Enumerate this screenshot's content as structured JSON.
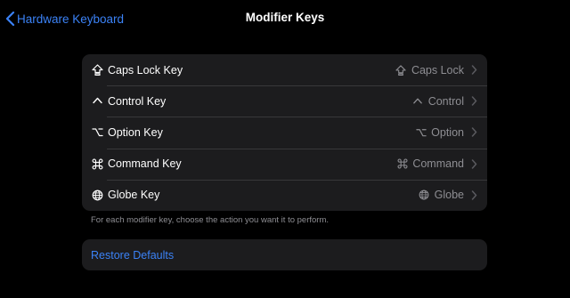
{
  "nav": {
    "back_label": "Hardware Keyboard",
    "title": "Modifier Keys"
  },
  "keys": [
    {
      "label": "Caps Lock Key",
      "value": "Caps Lock",
      "icon": "caps-lock-icon"
    },
    {
      "label": "Control Key",
      "value": "Control",
      "icon": "control-icon"
    },
    {
      "label": "Option Key",
      "value": "Option",
      "icon": "option-icon"
    },
    {
      "label": "Command Key",
      "value": "Command",
      "icon": "command-icon"
    },
    {
      "label": "Globe Key",
      "value": "Globe",
      "icon": "globe-icon"
    }
  ],
  "footnote": "For each modifier key, choose the action you want it to perform.",
  "restore_label": "Restore Defaults",
  "colors": {
    "background": "#000000",
    "group_background": "#1c1c1e",
    "accent": "#3b82f6",
    "secondary_text": "#8e8e93",
    "separator": "#38383a"
  }
}
